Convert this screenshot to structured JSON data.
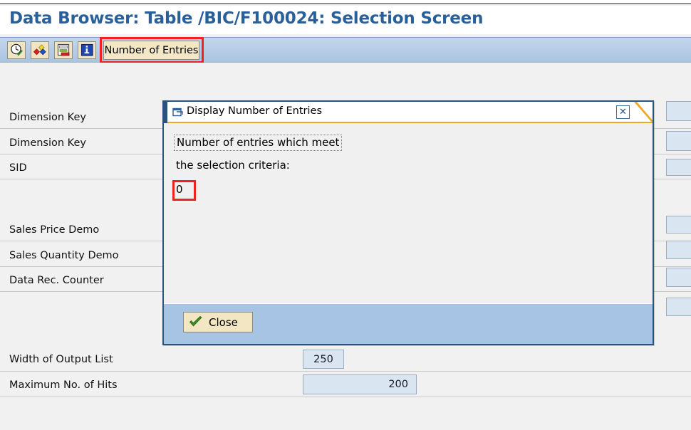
{
  "window": {
    "page_title": "Data Browser: Table /BIC/F100024: Selection Screen"
  },
  "toolbar": {
    "icons": [
      {
        "name": "execute-clock-icon",
        "tooltip": "Execute"
      },
      {
        "name": "execute-variant-icon",
        "tooltip": "Execute with Variant"
      },
      {
        "name": "output-list-icon",
        "tooltip": "Output List"
      },
      {
        "name": "info-icon",
        "tooltip": "Information"
      }
    ],
    "number_of_entries_label": "Number of Entries",
    "highlight_color": "#ee2222"
  },
  "form": {
    "rows": [
      {
        "label": "Dimension Key"
      },
      {
        "label": "Dimension Key"
      },
      {
        "label": "SID"
      },
      {
        "label": "Sales Price Demo"
      },
      {
        "label": "Sales Quantity Demo"
      },
      {
        "label": "Data Rec. Counter"
      }
    ],
    "width_of_output_list": {
      "label": "Width of Output List",
      "value": "250"
    },
    "maximum_no_of_hits": {
      "label": "Maximum No. of Hits",
      "value": "200"
    }
  },
  "dialog": {
    "title": "Display Number of Entries",
    "title_icon": "dialog-window-icon",
    "close_icon": "close-icon",
    "message_line1": "Number of entries which meet",
    "message_line2": "the selection criteria:",
    "count_value": "0",
    "close_button_label": "Close",
    "accent_color": "#f0a828",
    "border_color": "#28537f",
    "footer_color": "#a8c4e4"
  }
}
